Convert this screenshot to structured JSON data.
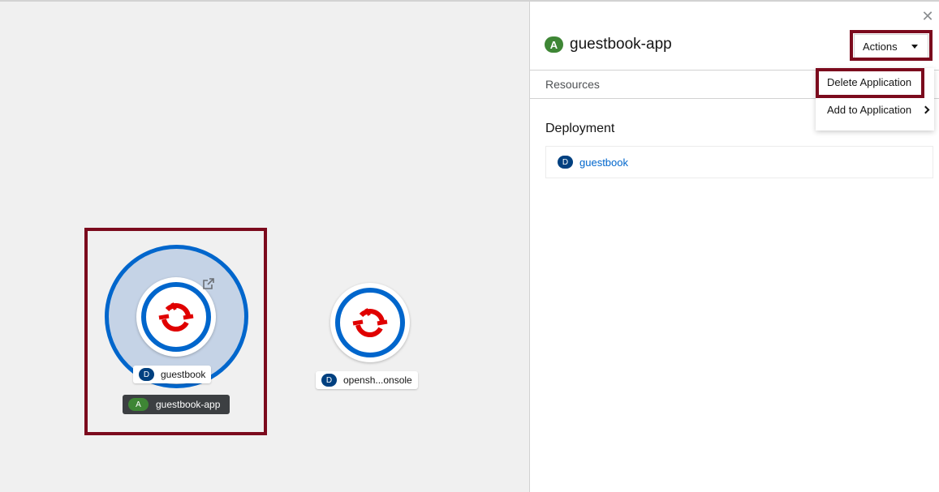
{
  "topology": {
    "nodes": [
      {
        "label": "guestbook",
        "kind_badge": "D"
      },
      {
        "label": "opensh...onsole",
        "kind_badge": "D"
      }
    ],
    "application_group": {
      "label": "guestbook-app",
      "kind_badge": "A"
    }
  },
  "side_panel": {
    "title": "guestbook-app",
    "title_badge": "A",
    "actions_label": "Actions",
    "tabs": [
      {
        "label": "Resources"
      }
    ],
    "actions_menu": [
      {
        "label": "Delete Application"
      },
      {
        "label": "Add to Application"
      }
    ],
    "section": {
      "title": "Deployment",
      "items": [
        {
          "badge": "D",
          "name": "guestbook"
        }
      ]
    }
  },
  "colors": {
    "accent_blue": "#0066cc",
    "highlight": "#7b0a1d",
    "app_badge_green": "#3e8635",
    "deploy_badge_navy": "#004080",
    "openshift_red": "#e00000"
  },
  "icons": {
    "close": "close-icon",
    "external_link": "external-link-icon",
    "caret": "caret-down-icon",
    "submenu": "chevron-right-icon",
    "node_logo": "openshift-logo-icon"
  }
}
